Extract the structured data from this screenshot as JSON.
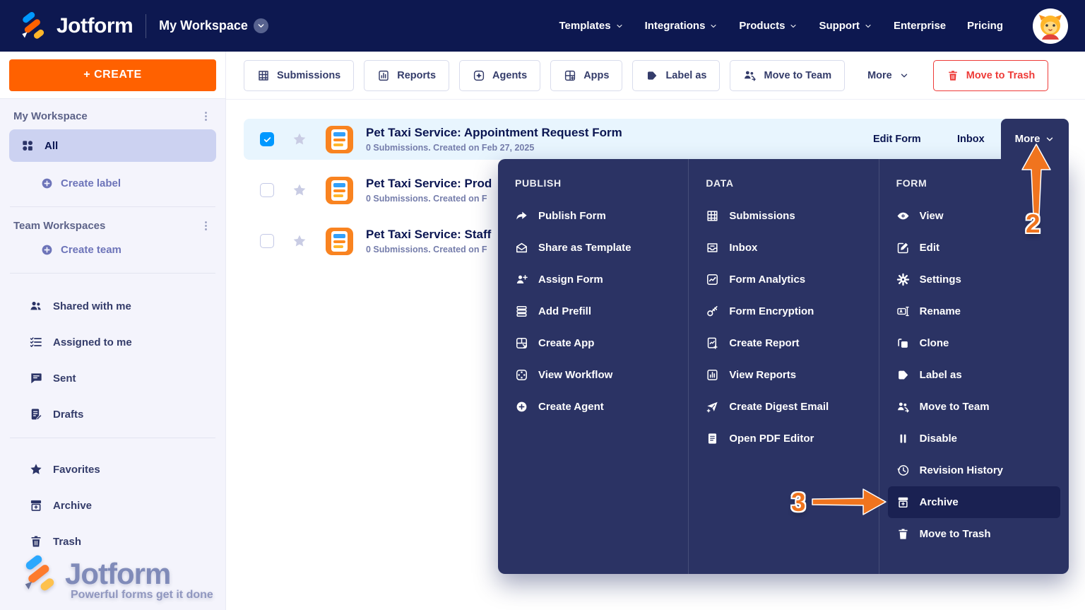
{
  "navbar": {
    "brand": "Jotform",
    "workspace": "My Workspace",
    "links": [
      {
        "label": "Templates",
        "chevron": true
      },
      {
        "label": "Integrations",
        "chevron": true
      },
      {
        "label": "Products",
        "chevron": true
      },
      {
        "label": "Support",
        "chevron": true
      },
      {
        "label": "Enterprise",
        "chevron": false
      },
      {
        "label": "Pricing",
        "chevron": false
      }
    ]
  },
  "toolbar": {
    "buttons": [
      {
        "label": "Submissions",
        "icon": "grid-icon"
      },
      {
        "label": "Reports",
        "icon": "report-icon"
      },
      {
        "label": "Agents",
        "icon": "agent-icon"
      },
      {
        "label": "Apps",
        "icon": "apps-icon"
      },
      {
        "label": "Label as",
        "icon": "tag-icon"
      },
      {
        "label": "Move to Team",
        "icon": "team-icon"
      }
    ],
    "more_label": "More",
    "trash_label": "Move to Trash"
  },
  "sidebar": {
    "create_button": "+ CREATE",
    "my_workspace": {
      "header": "My Workspace",
      "all": "All",
      "create_label": "Create label"
    },
    "team": {
      "header": "Team Workspaces",
      "create_team": "Create team"
    },
    "nav_items": [
      {
        "label": "Shared with me",
        "icon": "people-icon"
      },
      {
        "label": "Assigned to me",
        "icon": "checklist-icon"
      },
      {
        "label": "Sent",
        "icon": "chat-icon"
      },
      {
        "label": "Drafts",
        "icon": "draft-icon"
      }
    ],
    "nav_items_bottom": [
      {
        "label": "Favorites",
        "icon": "star-icon"
      },
      {
        "label": "Archive",
        "icon": "archive-icon"
      },
      {
        "label": "Trash",
        "icon": "trash-icon"
      }
    ],
    "watermark": {
      "brand": "Jotform",
      "tagline": "Powerful forms get it done"
    }
  },
  "forms": [
    {
      "title": "Pet Taxi Service: Appointment Request Form",
      "meta": "0 Submissions. Created on Feb 27, 2025",
      "checked": true,
      "starred": false,
      "actions": {
        "edit": "Edit Form",
        "inbox": "Inbox",
        "more": "More"
      }
    },
    {
      "title": "Pet Taxi Service: Prod",
      "meta": "0 Submissions. Created on F",
      "checked": false,
      "starred": false
    },
    {
      "title": "Pet Taxi Service: Staff",
      "meta": "0 Submissions. Created on F",
      "checked": false,
      "starred": false
    }
  ],
  "menu": {
    "publish": {
      "header": "PUBLISH",
      "items": [
        {
          "label": "Publish Form",
          "icon": "share-icon"
        },
        {
          "label": "Share as Template",
          "icon": "template-icon"
        },
        {
          "label": "Assign Form",
          "icon": "assign-person-icon"
        },
        {
          "label": "Add Prefill",
          "icon": "prefill-stack-icon"
        },
        {
          "label": "Create App",
          "icon": "create-app-icon"
        },
        {
          "label": "View Workflow",
          "icon": "workflow-icon"
        },
        {
          "label": "Create Agent",
          "icon": "plus-circle-icon"
        }
      ]
    },
    "data": {
      "header": "DATA",
      "items": [
        {
          "label": "Submissions",
          "icon": "grid-icon"
        },
        {
          "label": "Inbox",
          "icon": "inbox-icon"
        },
        {
          "label": "Form Analytics",
          "icon": "analytics-icon"
        },
        {
          "label": "Form Encryption",
          "icon": "key-icon"
        },
        {
          "label": "Create Report",
          "icon": "report-plus-icon"
        },
        {
          "label": "View Reports",
          "icon": "report-icon"
        },
        {
          "label": "Create Digest Email",
          "icon": "digest-email-icon"
        },
        {
          "label": "Open PDF Editor",
          "icon": "pdf-doc-icon"
        }
      ]
    },
    "form": {
      "header": "FORM",
      "highlighted": "Archive",
      "items": [
        {
          "label": "View",
          "icon": "eye-icon"
        },
        {
          "label": "Edit",
          "icon": "edit-icon"
        },
        {
          "label": "Settings",
          "icon": "gear-icon"
        },
        {
          "label": "Rename",
          "icon": "rename-icon"
        },
        {
          "label": "Clone",
          "icon": "clone-icon"
        },
        {
          "label": "Label as",
          "icon": "tag-icon"
        },
        {
          "label": "Move to Team",
          "icon": "team-icon"
        },
        {
          "label": "Disable",
          "icon": "pause-icon"
        },
        {
          "label": "Revision History",
          "icon": "history-icon"
        },
        {
          "label": "Archive",
          "icon": "archive-icon"
        },
        {
          "label": "Move to Trash",
          "icon": "trash-icon"
        }
      ]
    }
  },
  "annotations": {
    "step_2": "2",
    "step_3": "3"
  },
  "colors": {
    "navbar": "#0d1850",
    "menu": "#2b3364",
    "menu_highlight": "#1a2152",
    "orange": "#ff6100",
    "arrow_orange": "#f0741e",
    "red": "#ee3b38",
    "checkbox_blue": "#0098ff",
    "row_selected": "#e8f5fe",
    "sidebar_selected": "#ccd2f1",
    "ink": "#0a1551"
  }
}
